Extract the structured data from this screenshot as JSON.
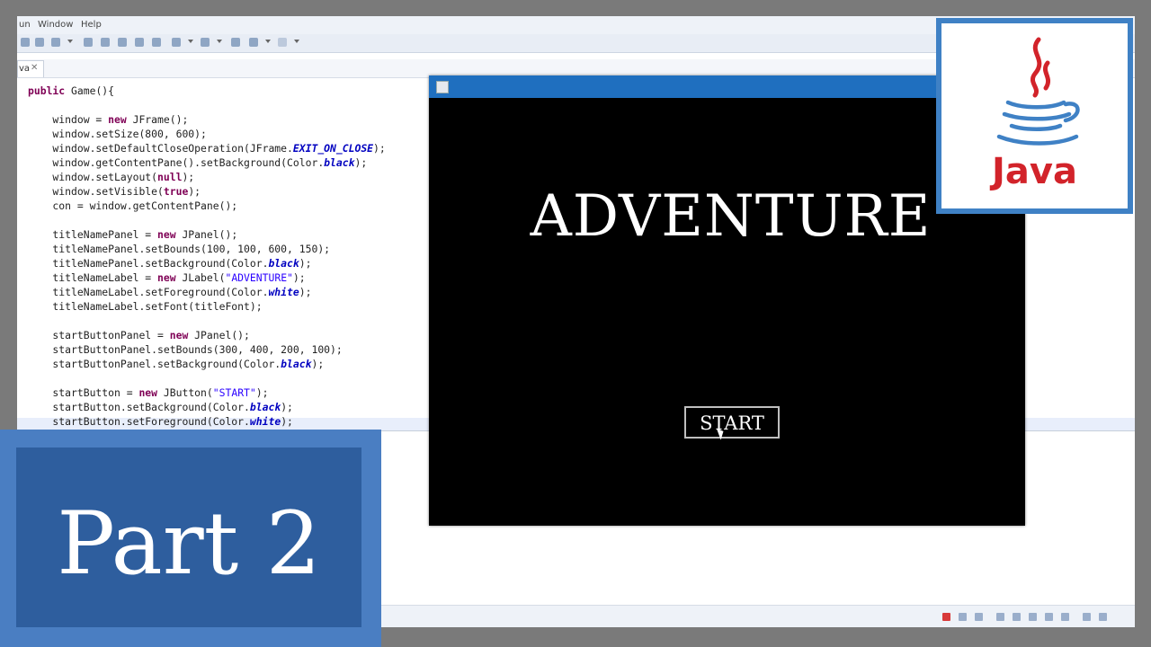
{
  "ide": {
    "menu": [
      "un",
      "Window",
      "Help"
    ],
    "tab_label": "va",
    "code": [
      [
        {
          "t": "public",
          "c": "kw"
        },
        {
          "t": " Game(){"
        }
      ],
      [],
      [
        {
          "t": "    window = "
        },
        {
          "t": "new",
          "c": "kw"
        },
        {
          "t": " JFrame();"
        }
      ],
      [
        {
          "t": "    window.setSize(800, 600);"
        }
      ],
      [
        {
          "t": "    window.setDefaultCloseOperation(JFrame."
        },
        {
          "t": "EXIT_ON_CLOSE",
          "c": "const"
        },
        {
          "t": ");"
        }
      ],
      [
        {
          "t": "    window.getContentPane().setBackground(Color."
        },
        {
          "t": "black",
          "c": "const"
        },
        {
          "t": ");"
        }
      ],
      [
        {
          "t": "    window.setLayout("
        },
        {
          "t": "null",
          "c": "kw"
        },
        {
          "t": ");"
        }
      ],
      [
        {
          "t": "    window.setVisible("
        },
        {
          "t": "true",
          "c": "kw"
        },
        {
          "t": ");"
        }
      ],
      [
        {
          "t": "    con = window.getContentPane();"
        }
      ],
      [],
      [
        {
          "t": "    titleNamePanel = "
        },
        {
          "t": "new",
          "c": "kw"
        },
        {
          "t": " JPanel();"
        }
      ],
      [
        {
          "t": "    titleNamePanel.setBounds(100, 100, 600, 150);"
        }
      ],
      [
        {
          "t": "    titleNamePanel.setBackground(Color."
        },
        {
          "t": "black",
          "c": "const"
        },
        {
          "t": ");"
        }
      ],
      [
        {
          "t": "    titleNameLabel = "
        },
        {
          "t": "new",
          "c": "kw"
        },
        {
          "t": " JLabel("
        },
        {
          "t": "\"ADVENTURE\"",
          "c": "str"
        },
        {
          "t": ");"
        }
      ],
      [
        {
          "t": "    titleNameLabel.setForeground(Color."
        },
        {
          "t": "white",
          "c": "const"
        },
        {
          "t": ");"
        }
      ],
      [
        {
          "t": "    titleNameLabel.setFont(titleFont);"
        }
      ],
      [],
      [
        {
          "t": "    startButtonPanel = "
        },
        {
          "t": "new",
          "c": "kw"
        },
        {
          "t": " JPanel();"
        }
      ],
      [
        {
          "t": "    startButtonPanel.setBounds(300, 400, 200, 100);"
        }
      ],
      [
        {
          "t": "    startButtonPanel.setBackground(Color."
        },
        {
          "t": "black",
          "c": "const"
        },
        {
          "t": ");"
        }
      ],
      [],
      [
        {
          "t": "    startButton = "
        },
        {
          "t": "new",
          "c": "kw"
        },
        {
          "t": " JButton("
        },
        {
          "t": "\"START\"",
          "c": "str"
        },
        {
          "t": ");"
        }
      ],
      [
        {
          "t": "    startButton.setBackground(Color."
        },
        {
          "t": "black",
          "c": "const"
        },
        {
          "t": ");"
        }
      ],
      [
        {
          "t": "    startButton.setForeground(Color."
        },
        {
          "t": "white",
          "c": "const"
        },
        {
          "t": ");"
        }
      ]
    ]
  },
  "game": {
    "title": "ADVENTURE",
    "start_label": "START"
  },
  "logo": {
    "text": "Java"
  },
  "banner": {
    "text": "Part 2"
  },
  "colors": {
    "accent_blue": "#3f81c5",
    "banner_dark": "#2e5e9e",
    "java_red": "#d2232a",
    "game_bg": "#000000"
  }
}
